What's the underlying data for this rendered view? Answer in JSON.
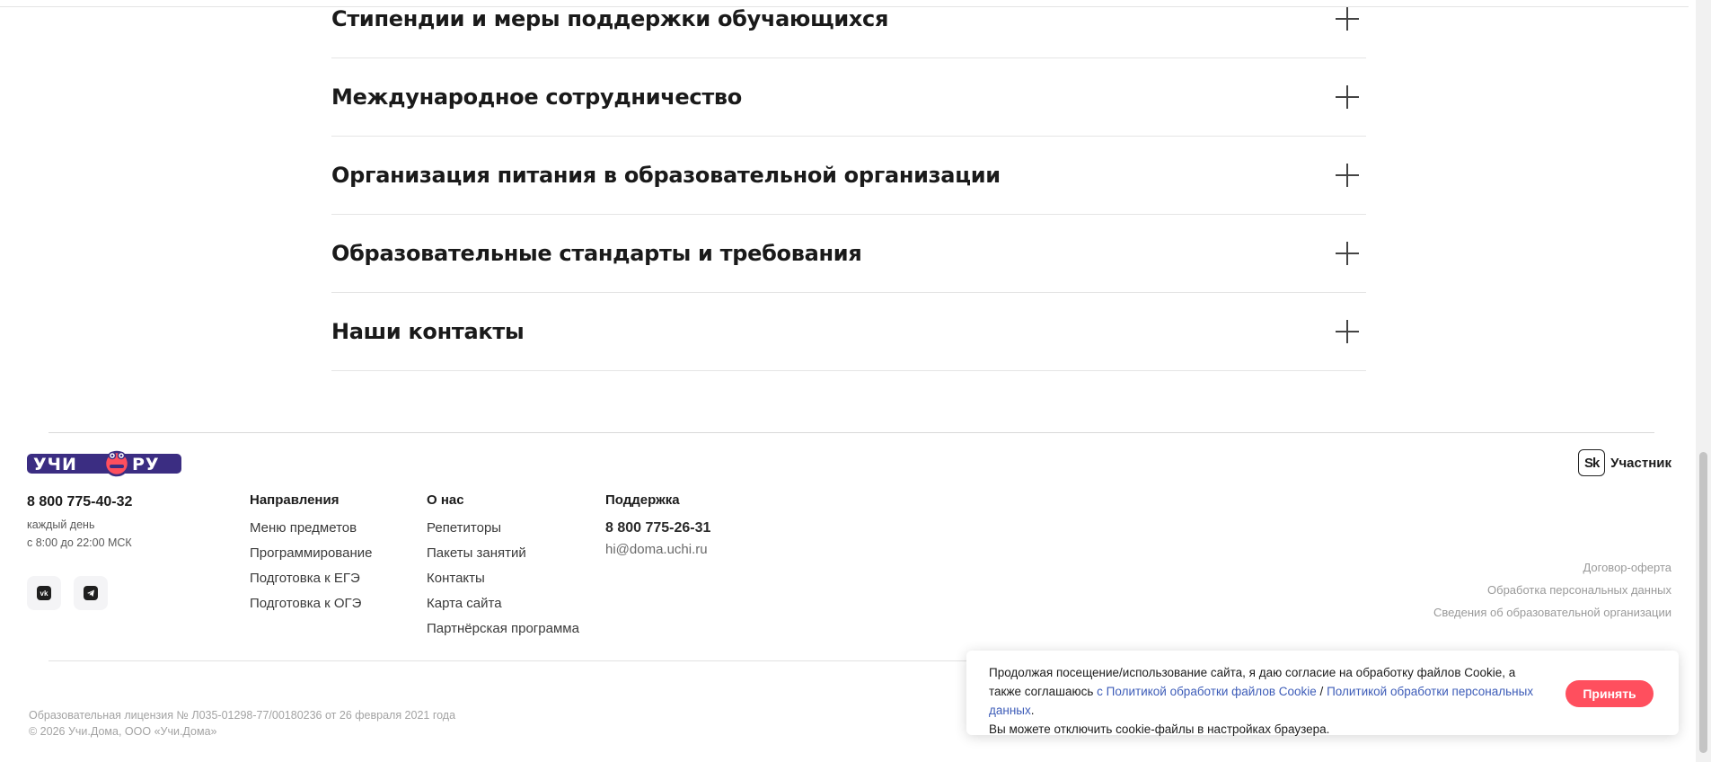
{
  "accordion": {
    "items": [
      {
        "title": "Стипендии и меры поддержки обучающихся"
      },
      {
        "title": "Международное сотрудничество"
      },
      {
        "title": "Организация питания в образовательной организации"
      },
      {
        "title": "Образовательные стандарты и требования"
      },
      {
        "title": "Наши контакты"
      }
    ]
  },
  "footer": {
    "logo_text": "УЧИ.РУ",
    "phone": "8 800 775-40-32",
    "hours_line1": "каждый день",
    "hours_line2": "с 8:00 до 22:00 МСК",
    "social": {
      "vk": "vk-icon",
      "telegram": "telegram-icon"
    },
    "columns": {
      "directions": {
        "heading": "Направления",
        "links": [
          "Меню предметов",
          "Программирование",
          "Подготовка к ЕГЭ",
          "Подготовка к ОГЭ"
        ]
      },
      "about": {
        "heading": "О нас",
        "links": [
          "Репетиторы",
          "Пакеты занятий",
          "Контакты",
          "Карта сайта",
          "Партнёрская программа"
        ]
      },
      "support": {
        "heading": "Поддержка",
        "phone": "8 800 775-26-31",
        "email": "hi@doma.uchi.ru"
      }
    },
    "skolkovo": {
      "mark": "Sk",
      "label": "Участник"
    },
    "legal_links": [
      "Договор-оферта",
      "Обработка персональных данных",
      "Сведения об образовательной организации"
    ],
    "license": "Образовательная лицензия № Л035-01298-77/00180236 от 26 февраля 2021 года",
    "copyright": "© 2026 Учи.Дома, ООО «Учи.Дома»"
  },
  "cookie": {
    "text_part1": "Продолжая посещение/использование сайта, я даю согласие на обработку файлов Cookie, а также соглашаюсь ",
    "link1": "с Политикой обработки файлов Cookie",
    "separator": " / ",
    "link2": "Политикой обработки персональных данных",
    "text_part2": ".",
    "text_line3": "Вы можете отключить cookie-файлы в настройках браузера.",
    "accept_label": "Принять"
  },
  "colors": {
    "accent": "#ff4f5e",
    "logo_purple": "#3b2d82",
    "link_blue": "#3d5cb8"
  }
}
